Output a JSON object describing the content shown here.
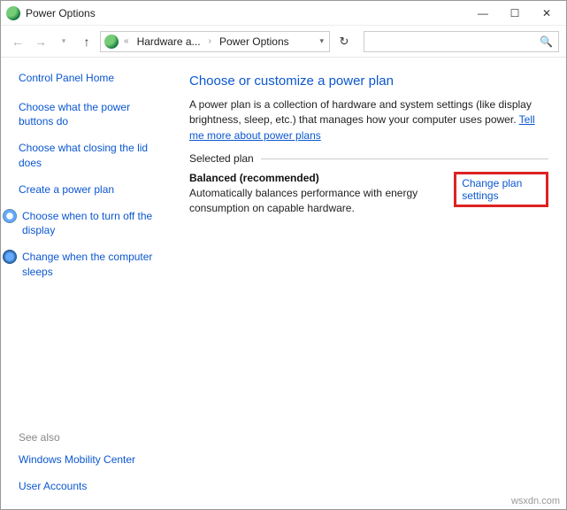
{
  "titlebar": {
    "title": "Power Options"
  },
  "breadcrumb": {
    "item1": "Hardware a...",
    "item2": "Power Options"
  },
  "sidebar": {
    "home": "Control Panel Home",
    "links": [
      "Choose what the power buttons do",
      "Choose what closing the lid does",
      "Create a power plan",
      "Choose when to turn off the display",
      "Change when the computer sleeps"
    ],
    "see_also_title": "See also",
    "see_also": [
      "Windows Mobility Center",
      "User Accounts"
    ]
  },
  "main": {
    "heading": "Choose or customize a power plan",
    "desc_text": "A power plan is a collection of hardware and system settings (like display brightness, sleep, etc.) that manages how your computer uses power. ",
    "desc_link": "Tell me more about power plans",
    "selected_plan_label": "Selected plan",
    "plan_name": "Balanced (recommended)",
    "change_link": "Change plan settings",
    "plan_desc": "Automatically balances performance with energy consumption on capable hardware."
  },
  "watermark": "wsxdn.com"
}
